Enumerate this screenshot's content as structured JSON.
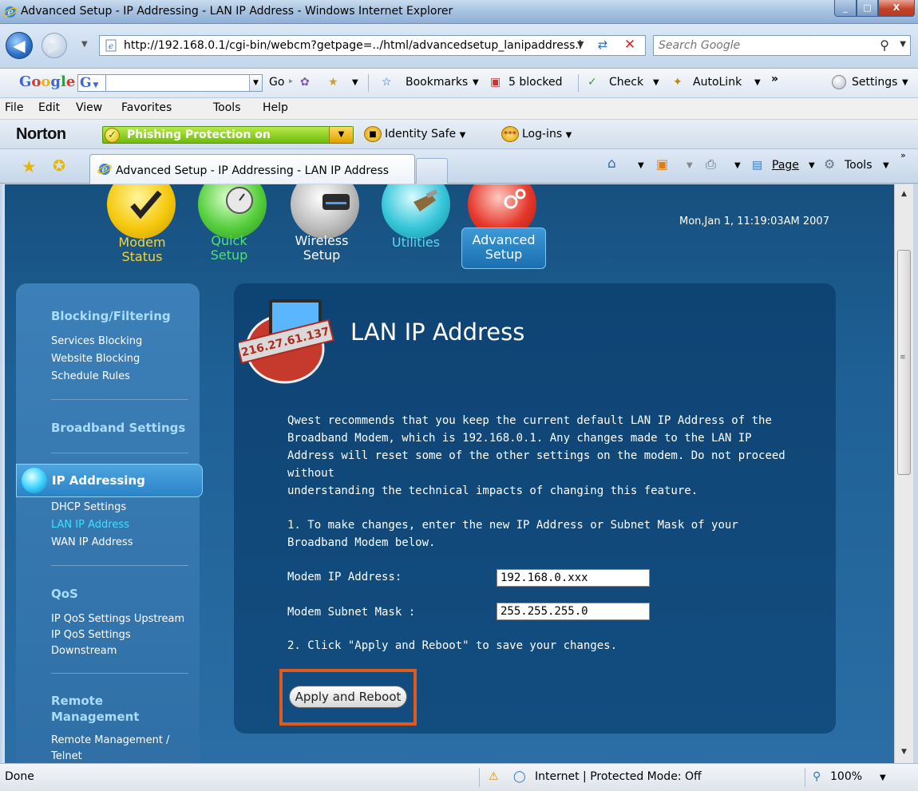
{
  "window": {
    "title": "Advanced Setup - IP Addressing - LAN IP Address - Windows Internet Explorer",
    "min_label": "_",
    "max_label": "□",
    "close_label": "X"
  },
  "address": {
    "url": "http://192.168.0.1/cgi-bin/webcm?getpage=../html/advancedsetup_lanipaddress.html",
    "search_placeholder": "Search Google"
  },
  "google_toolbar": {
    "go": "Go",
    "bookmarks": "Bookmarks",
    "blocked": "5 blocked",
    "check": "Check",
    "autolink": "AutoLink",
    "more": "»",
    "settings": "Settings"
  },
  "menu": [
    "File",
    "Edit",
    "View",
    "Favorites",
    "Tools",
    "Help"
  ],
  "norton": {
    "logo": "Norton",
    "phishing": "Phishing Protection on",
    "identity": "Identity Safe",
    "logins": "Log-ins"
  },
  "tab": {
    "label": "Advanced Setup - IP Addressing - LAN IP Address"
  },
  "commandbar": {
    "page": "Page",
    "tools": "Tools"
  },
  "site": {
    "datetime": "Mon,Jan 1, 11:19:03AM 2007",
    "nav": [
      {
        "line1": "Modem",
        "line2": "Status"
      },
      {
        "line1": "Quick",
        "line2": "Setup"
      },
      {
        "line1": "Wireless",
        "line2": "Setup"
      },
      {
        "line1": "Utilities",
        "line2": ""
      },
      {
        "line1": "Advanced",
        "line2": "Setup"
      }
    ],
    "sidebar": {
      "blocking_head": "Blocking/Filtering",
      "blocking_links": [
        "Services Blocking",
        "Website Blocking",
        "Schedule Rules"
      ],
      "broadband_head": "Broadband Settings",
      "ip_head": "IP Addressing",
      "ip_links": [
        "DHCP Settings",
        "LAN IP Address",
        "WAN IP Address"
      ],
      "qos_head": "QoS",
      "qos_links": [
        "IP QoS Settings Upstream",
        "IP QoS Settings",
        "Downstream"
      ],
      "remote_head_1": "Remote",
      "remote_head_2": "Management",
      "remote_links": [
        "Remote Management /",
        "Telnet"
      ]
    },
    "main": {
      "badge": "216.27.61.137",
      "title": "LAN IP Address",
      "para1": "Qwest recommends that you keep the current default LAN IP Address of the\nBroadband Modem, which is 192.168.0.1. Any changes made to the LAN IP\nAddress will reset some of the other settings on the modem. Do not proceed\nwithout\nunderstanding the technical impacts of changing this feature.",
      "step1": "1. To make changes, enter the new IP Address or Subnet Mask of your\nBroadband Modem below.",
      "ip_label": "Modem IP Address:",
      "ip_value": "192.168.0.xxx",
      "mask_label": "Modem Subnet Mask :",
      "mask_value": "255.255.255.0",
      "step2": "2. Click \"Apply and Reboot\" to save your changes.",
      "apply_button": "Apply and Reboot"
    }
  },
  "status": {
    "text": "Done",
    "zone": "Internet | Protected Mode: Off",
    "zoom": "100%"
  },
  "colors": {
    "highlight": "#e05a1d",
    "sidebar_head": "#a9dcff",
    "sidebar_active": "#3fe0ff"
  }
}
